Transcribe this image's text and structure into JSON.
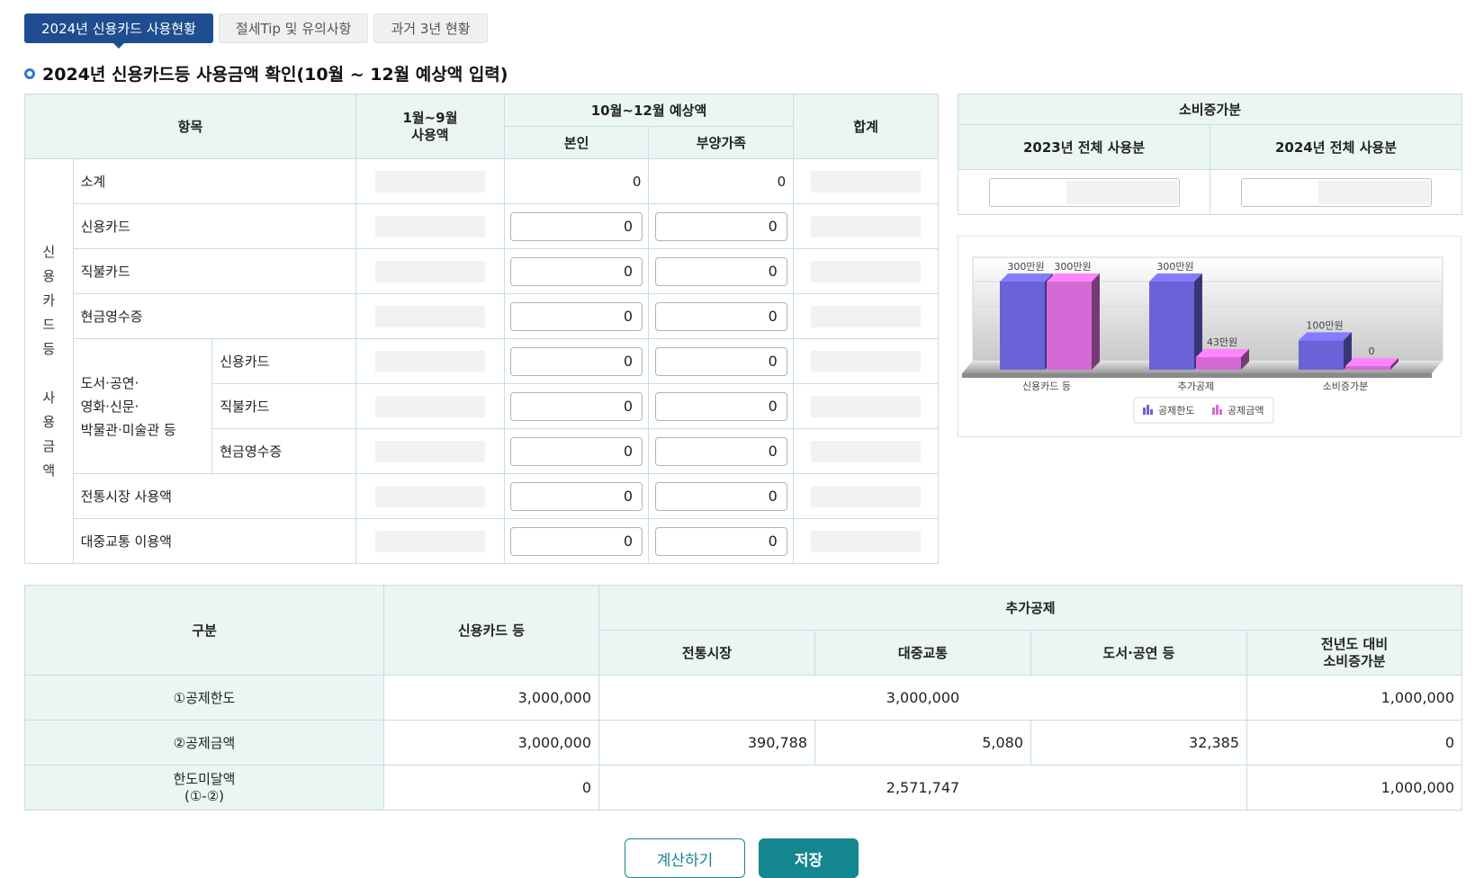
{
  "tabs": [
    {
      "label": "2024년 신용카드 사용현황",
      "active": true
    },
    {
      "label": "절세Tip 및 유의사항",
      "active": false
    },
    {
      "label": "과거 3년 현황",
      "active": false
    }
  ],
  "section_title": "2024년 신용카드등 사용금액 확인(10월 ~ 12월 예상액 입력)",
  "usage_table": {
    "headers": {
      "item": "항목",
      "jan_sep": "1월~9월 사용액",
      "oct_dec": "10월~12월 예상액",
      "self": "본인",
      "dependents": "부양가족",
      "total": "합계"
    },
    "group_label": [
      "신",
      "용",
      "카",
      "드",
      "등",
      "",
      "사",
      "용",
      "금",
      "액"
    ],
    "subgroup_label": "도서·공연·\n영화·신문·\n박물관·미술관 등",
    "rows": {
      "subtotal": {
        "label": "소계",
        "self": "0",
        "dependents": "0"
      },
      "credit_card": {
        "label": "신용카드",
        "self": "0",
        "dependents": "0"
      },
      "debit_card": {
        "label": "직불카드",
        "self": "0",
        "dependents": "0"
      },
      "cash_receipt": {
        "label": "현금영수증",
        "self": "0",
        "dependents": "0"
      },
      "culture_credit": {
        "label": "신용카드",
        "self": "0",
        "dependents": "0"
      },
      "culture_debit": {
        "label": "직불카드",
        "self": "0",
        "dependents": "0"
      },
      "culture_cash": {
        "label": "현금영수증",
        "self": "0",
        "dependents": "0"
      },
      "market": {
        "label": "전통시장 사용액",
        "self": "0",
        "dependents": "0"
      },
      "transit": {
        "label": "대중교통 이용액",
        "self": "0",
        "dependents": "0"
      }
    }
  },
  "increase_table": {
    "title": "소비증가분",
    "col_2023": "2023년 전체 사용분",
    "col_2024": "2024년 전체 사용분"
  },
  "chart_data": {
    "type": "bar",
    "categories": [
      "신용카드 등",
      "추가공제",
      "소비증가분"
    ],
    "series": [
      {
        "name": "공제한도",
        "values": [
          300,
          300,
          100
        ],
        "labels": [
          "300만원",
          "300만원",
          "100만원"
        ],
        "color": "#6a62d6"
      },
      {
        "name": "공제금액",
        "values": [
          300,
          43,
          0
        ],
        "labels": [
          "300만원",
          "43만원",
          "0"
        ],
        "color": "#d46ad6"
      }
    ],
    "unit": "만원",
    "ylim": [
      0,
      400
    ],
    "legend": "bottom-center"
  },
  "summary_table": {
    "headers": {
      "category": "구분",
      "credit_etc": "신용카드 등",
      "additional": "추가공제",
      "market": "전통시장",
      "transit": "대중교통",
      "books": "도서·공연 등",
      "increase": "전년도 대비\n소비증가분"
    },
    "rows": [
      {
        "label": "①공제한도",
        "credit_etc": "3,000,000",
        "additional_merged": "3,000,000",
        "increase": "1,000,000"
      },
      {
        "label": "②공제금액",
        "credit_etc": "3,000,000",
        "market": "390,788",
        "transit": "5,080",
        "books": "32,385",
        "increase": "0"
      },
      {
        "label": "한도미달액\n(①-②)",
        "credit_etc": "0",
        "additional_merged": "2,571,747",
        "increase": "1,000,000"
      }
    ]
  },
  "buttons": {
    "calculate": "계산하기",
    "save": "저장"
  },
  "colors": {
    "tab_active": "#1e4e8f",
    "header_bg": "#eaf5f4",
    "border": "#c6dfdd",
    "button_teal": "#14868f",
    "title_bullet": "#2a7ad8"
  }
}
